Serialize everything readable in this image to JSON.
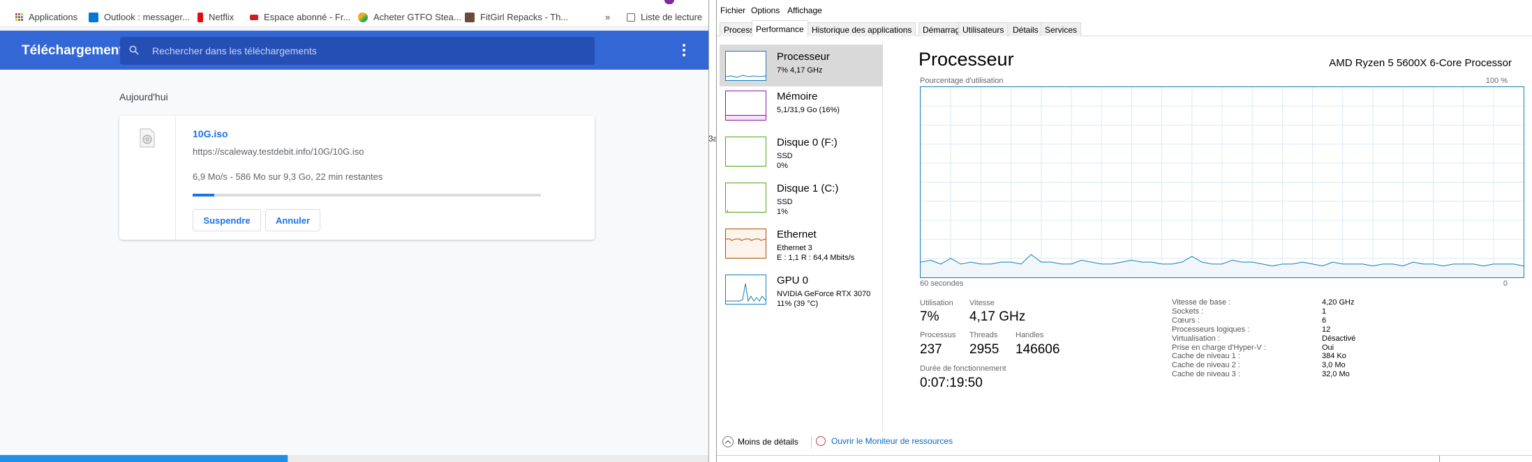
{
  "bookmarks": {
    "items": [
      {
        "label": "Applications",
        "icon": "apps-grid-icon"
      },
      {
        "label": "Outlook : messager...",
        "icon": "outlook-icon"
      },
      {
        "label": "Netflix",
        "icon": "netflix-icon"
      },
      {
        "label": "Espace abonné - Fr...",
        "icon": "free-icon"
      },
      {
        "label": "Acheter GTFO Stea...",
        "icon": "steam-icon"
      },
      {
        "label": "FitGirl Repacks - Th...",
        "icon": "fitgirl-icon"
      }
    ],
    "more": "»",
    "reading_list": "Liste de lecture"
  },
  "downloads": {
    "title": "Téléchargements",
    "search_placeholder": "Rechercher dans les téléchargements",
    "section": "Aujourd'hui",
    "item": {
      "filename": "10G.iso",
      "url": "https://scaleway.testdebit.info/10G/10G.iso",
      "status": "6,9 Mo/s - 586 Mo sur 9,3 Go, 22 min restantes",
      "progress_fraction": 0.062,
      "pause_label": "Suspendre",
      "cancel_label": "Annuler"
    }
  },
  "gap_text": "3a",
  "taskmgr": {
    "menu": [
      "Fichier",
      "Options",
      "Affichage"
    ],
    "tabs": [
      "Processus",
      "Performance",
      "Historique des applications",
      "Démarrage",
      "Utilisateurs",
      "Détails",
      "Services"
    ],
    "active_tab": "Performance",
    "sidebar": [
      {
        "title": "Processeur",
        "l2": "7% 4,17 GHz",
        "l3": "",
        "color": "#117dbb"
      },
      {
        "title": "Mémoire",
        "l2": "5,1/31,9 Go (16%)",
        "l3": "",
        "color": "#8b12ae"
      },
      {
        "title": "Disque 0 (F:)",
        "l2": "SSD",
        "l3": "0%",
        "color": "#4da60c"
      },
      {
        "title": "Disque 1 (C:)",
        "l2": "SSD",
        "l3": "1%",
        "color": "#4da60c"
      },
      {
        "title": "Ethernet",
        "l2": "Ethernet 3",
        "l3": "E : 1,1 R : 64,4 Mbits/s",
        "color": "#a74f01"
      },
      {
        "title": "GPU 0",
        "l2": "NVIDIA GeForce RTX 3070",
        "l3": "11% (39 °C)",
        "color": "#117dbb"
      }
    ],
    "detail": {
      "title": "Processeur",
      "cpu_name": "AMD Ryzen 5 5600X 6-Core Processor",
      "usage_label": "Pourcentage d'utilisation",
      "max_label": "100 %",
      "time_label": "60 secondes",
      "min_label": "0",
      "stats": {
        "utilisation_label": "Utilisation",
        "utilisation": "7%",
        "vitesse_label": "Vitesse",
        "vitesse": "4,17 GHz",
        "processus_label": "Processus",
        "processus": "237",
        "threads_label": "Threads",
        "threads": "2955",
        "handles_label": "Handles",
        "handles": "146606",
        "uptime_label": "Durée de fonctionnement",
        "uptime": "0:07:19:50"
      },
      "specs": [
        {
          "k": "Vitesse de base :",
          "v": "4,20 GHz"
        },
        {
          "k": "Sockets :",
          "v": "1"
        },
        {
          "k": "Cœurs :",
          "v": "6"
        },
        {
          "k": "Processeurs logiques :",
          "v": "12"
        },
        {
          "k": "Virtualisation :",
          "v": "Désactivé"
        },
        {
          "k": "Prise en charge d'Hyper-V :",
          "v": "Oui"
        },
        {
          "k": "Cache de niveau 1 :",
          "v": "384 Ko"
        },
        {
          "k": "Cache de niveau 2 :",
          "v": "3,0 Mo"
        },
        {
          "k": "Cache de niveau 3 :",
          "v": "32,0 Mo"
        }
      ],
      "cpu_history": [
        8,
        9,
        7,
        10,
        7,
        8,
        7,
        7,
        8,
        8,
        7,
        12,
        8,
        8,
        7,
        7,
        9,
        8,
        7,
        7,
        8,
        9,
        8,
        8,
        7,
        7,
        8,
        11,
        8,
        7,
        7,
        9,
        8,
        8,
        7,
        6,
        7,
        7,
        8,
        7,
        6,
        8,
        7,
        7,
        7,
        6,
        7,
        7,
        6,
        8,
        7,
        7,
        6,
        7,
        7,
        7,
        6,
        7,
        7,
        7,
        6
      ]
    },
    "footer": {
      "fewer": "Moins de détails",
      "resmon": "Ouvrir le Moniteur de ressources"
    }
  }
}
